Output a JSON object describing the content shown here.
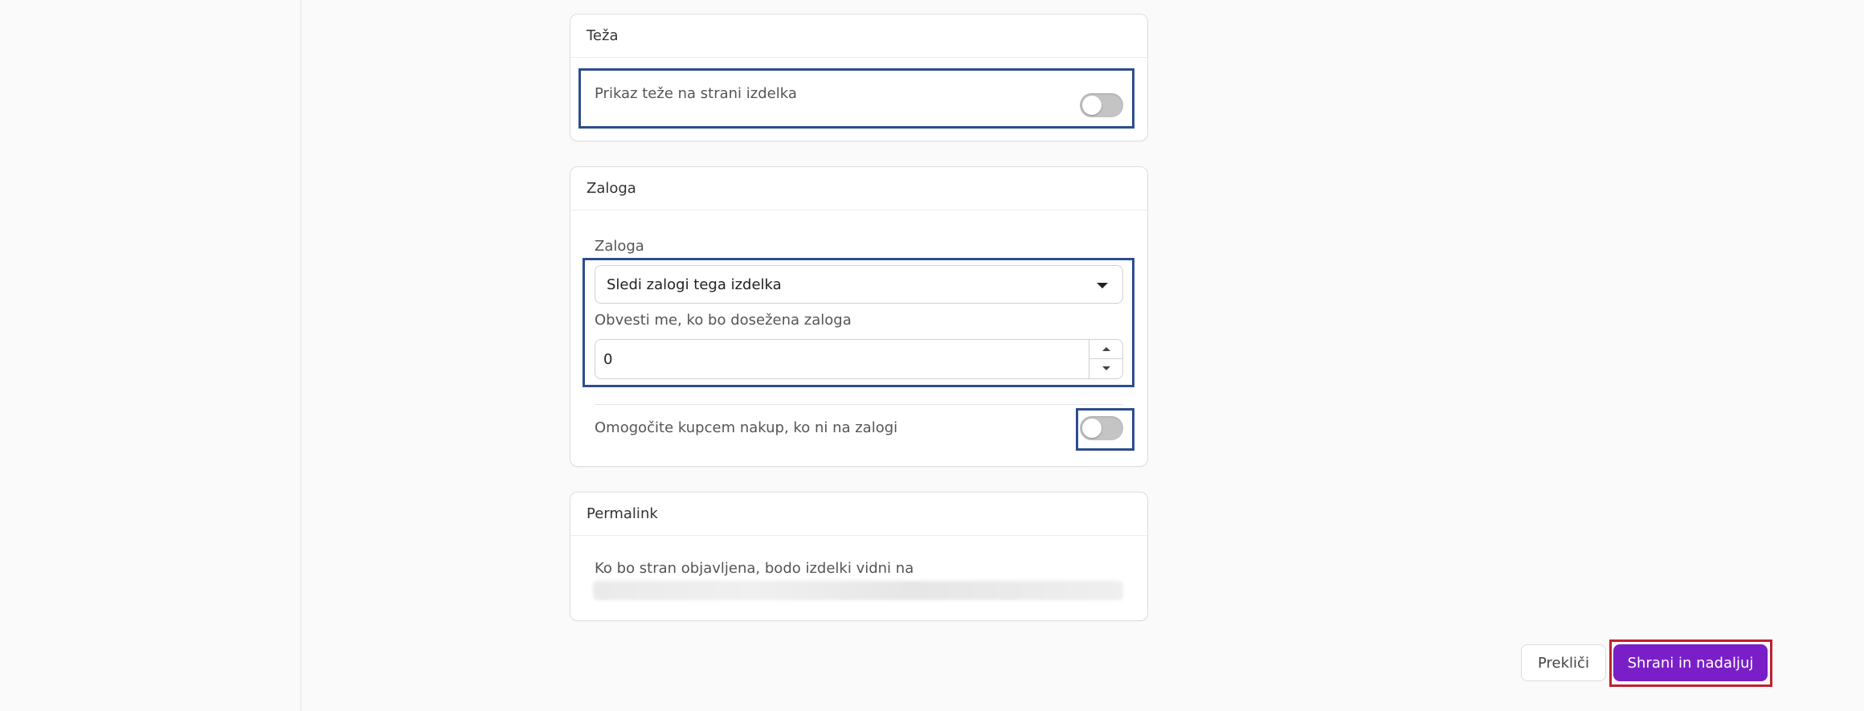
{
  "weight_card": {
    "title": "Teža",
    "show_weight_label": "Prikaz teže na strani izdelka",
    "show_weight_enabled": false
  },
  "stock_card": {
    "title": "Zaloga",
    "stock_label": "Zaloga",
    "stock_select_value": "Sledi zalogi tega izdelka",
    "notify_label": "Obvesti me, ko bo dosežena zaloga",
    "notify_value": "0",
    "backorder_label": "Omogočite kupcem nakup, ko ni na zalogi",
    "backorder_enabled": false
  },
  "permalink_card": {
    "title": "Permalink",
    "description": "Ko bo stran objavljena, bodo izdelki vidni na"
  },
  "actions": {
    "cancel_label": "Prekliči",
    "save_label": "Shrani in nadaljuj"
  },
  "colors": {
    "primary": "#7a1fc7",
    "highlight_blue": "#2d4d8f",
    "highlight_red": "#c0202e"
  }
}
